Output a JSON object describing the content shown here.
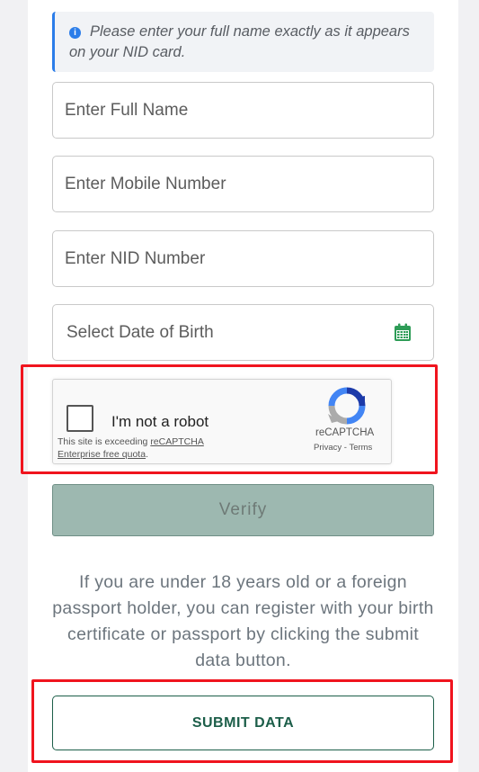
{
  "notice": {
    "icon": "info-icon",
    "text": "Please enter your full name exactly as it appears on your NID card."
  },
  "form": {
    "full_name_placeholder": "Enter Full Name",
    "mobile_placeholder": "Enter Mobile Number",
    "nid_placeholder": "Enter NID Number",
    "dob_placeholder": "Select Date of Birth",
    "dob_icon": "calendar-icon"
  },
  "captcha": {
    "label": "I'm not a robot",
    "quota_prefix": "This site is exceeding ",
    "quota_link": "reCAPTCHA Enterprise free quota",
    "quota_suffix": ".",
    "brand": "reCAPTCHA",
    "privacy": "Privacy",
    "separator": "-",
    "terms": "Terms",
    "checked": false
  },
  "verify_label": "Verify",
  "info_text": "If you are under 18 years old or a foreign passport holder, you can register with your birth certificate or passport by clicking the submit data button.",
  "submit_label": "SUBMIT DATA",
  "colors": {
    "accent": "#1c5e49",
    "info_blue": "#2b7de9",
    "verify_bg": "#9db8b0",
    "highlight_red": "#f0141e",
    "calendar_green": "#2e9c57"
  }
}
